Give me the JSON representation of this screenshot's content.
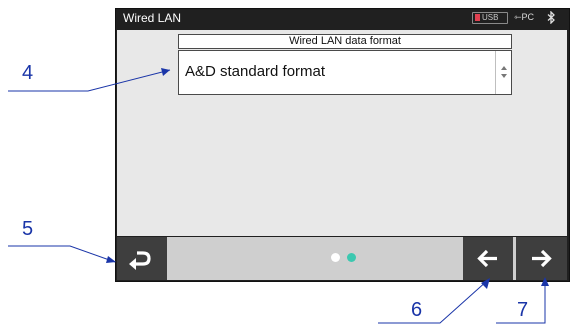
{
  "screen": {
    "title": "Wired LAN",
    "status": {
      "usb_label": "USB",
      "pc_label": "PC",
      "bluetooth_icon": "bluetooth-icon"
    },
    "field": {
      "label": "Wired LAN data format",
      "value": "A&D standard format",
      "spinner_icon": "up-down-arrows-icon"
    },
    "bottom_bar": {
      "back_icon": "return-arrow-icon",
      "prev_icon": "arrow-left-icon",
      "next_icon": "arrow-right-icon",
      "page_indicator": {
        "pages": 2,
        "current": 2
      }
    }
  },
  "callouts": {
    "n4": "4",
    "n5": "5",
    "n6": "6",
    "n7": "7"
  },
  "colors": {
    "screen_bg": "#202020",
    "content_bg": "#e8e8e8",
    "accent_dot": "#3cc8b0",
    "callout": "#1a35a8"
  }
}
